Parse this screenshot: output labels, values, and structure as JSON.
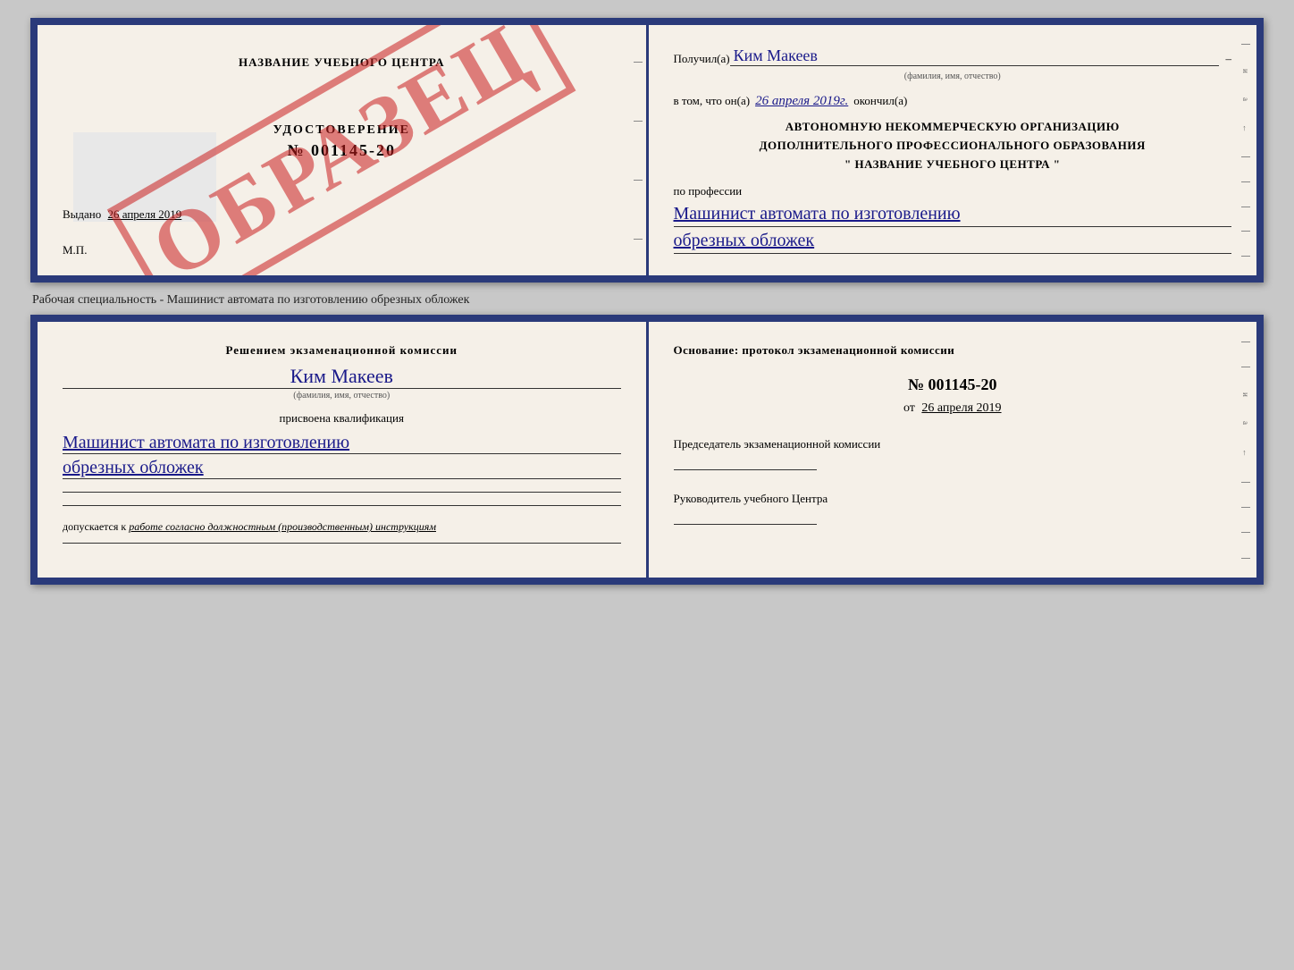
{
  "top_doc": {
    "left": {
      "center_title": "НАЗВАНИЕ УЧЕБНОГО ЦЕНТРА",
      "watermark": "ОБРАЗЕЦ",
      "udost_label": "УДОСТОВЕРЕНИЕ",
      "udost_number": "№ 001145-20",
      "vydano_label": "Выдано",
      "vydano_date": "26 апреля 2019",
      "mp_label": "М.П."
    },
    "right": {
      "poluchil_label": "Получил(а)",
      "poluchil_name": "Ким Макеев",
      "fio_hint": "(фамилия, имя, отчество)",
      "vtom_label": "в том, что он(а)",
      "vtom_date": "26 апреля 2019г.",
      "okonchil_label": "окончил(а)",
      "org_line1": "АВТОНОМНУЮ НЕКОММЕРЧЕСКУЮ ОРГАНИЗАЦИЮ",
      "org_line2": "ДОПОЛНИТЕЛЬНОГО ПРОФЕССИОНАЛЬНОГО ОБРАЗОВАНИЯ",
      "org_line3": "\"   НАЗВАНИЕ УЧЕБНОГО ЦЕНТРА   \"",
      "profession_label": "по профессии",
      "profession_line1": "Машинист автомата по изготовлению",
      "profession_line2": "обрезных обложек"
    }
  },
  "between_label": "Рабочая специальность - Машинист автомата по изготовлению обрезных обложек",
  "bottom_doc": {
    "left": {
      "resheniem_label": "Решением экзаменационной комиссии",
      "name": "Ким Макеев",
      "fio_hint": "(фамилия, имя, отчество)",
      "prisvoyena_label": "присвоена квалификация",
      "qual_line1": "Машинист автомата по изготовлению",
      "qual_line2": "обрезных обложек",
      "dopuskaetsya_label": "допускается к",
      "dopuskaetsya_text": "работе согласно должностным (производственным) инструкциям"
    },
    "right": {
      "osnovanie_label": "Основание: протокол экзаменационной комиссии",
      "protocol_number": "№ 001145-20",
      "ot_label": "от",
      "ot_date": "26 апреля 2019",
      "predsedatel_label": "Председатель экзаменационной комиссии",
      "rukovoditel_label": "Руководитель учебного Центра"
    }
  }
}
